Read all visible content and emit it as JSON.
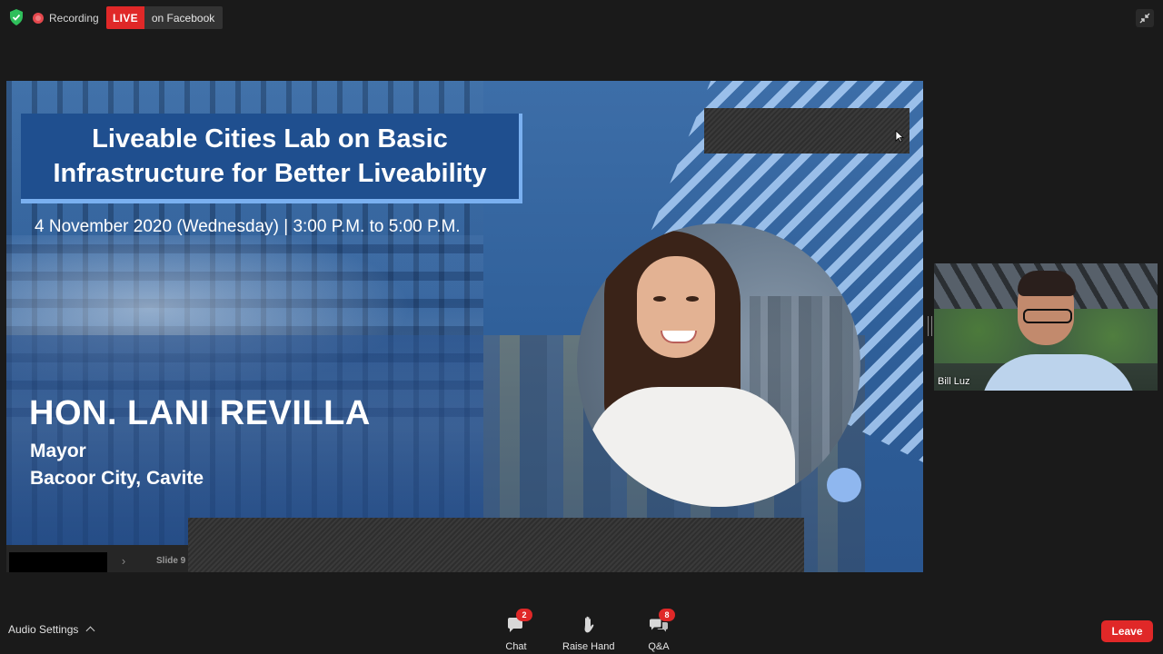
{
  "topbar": {
    "recording_label": "Recording",
    "live_badge": "LIVE",
    "live_target": "on Facebook"
  },
  "slide": {
    "title_line1": "Liveable Cities Lab on Basic",
    "title_line2": "Infrastructure for Better Liveability",
    "date_line": "4 November 2020 (Wednesday) | 3:00 P.M. to 5:00 P.M.",
    "speaker_name": "HON. LANI REVILLA",
    "speaker_role": "Mayor",
    "speaker_location": "Bacoor City, Cavite",
    "slide_number": "Slide 9"
  },
  "participant": {
    "name": "Bill Luz"
  },
  "toolbar": {
    "audio_settings": "Audio Settings",
    "chat_label": "Chat",
    "chat_badge": "2",
    "raise_hand_label": "Raise Hand",
    "qa_label": "Q&A",
    "qa_badge": "8",
    "leave_label": "Leave"
  },
  "icons": {
    "security": "shield-check-icon",
    "recording": "record-dot-icon",
    "exit_fullscreen": "exit-fullscreen-icon",
    "chat": "chat-bubble-icon",
    "raise_hand": "hand-icon",
    "qa": "qa-bubbles-icon"
  },
  "colors": {
    "live_red": "#e02828",
    "security_green": "#2fbf5b",
    "slide_blue": "#1f4f8f",
    "leave_red": "#e02828"
  }
}
